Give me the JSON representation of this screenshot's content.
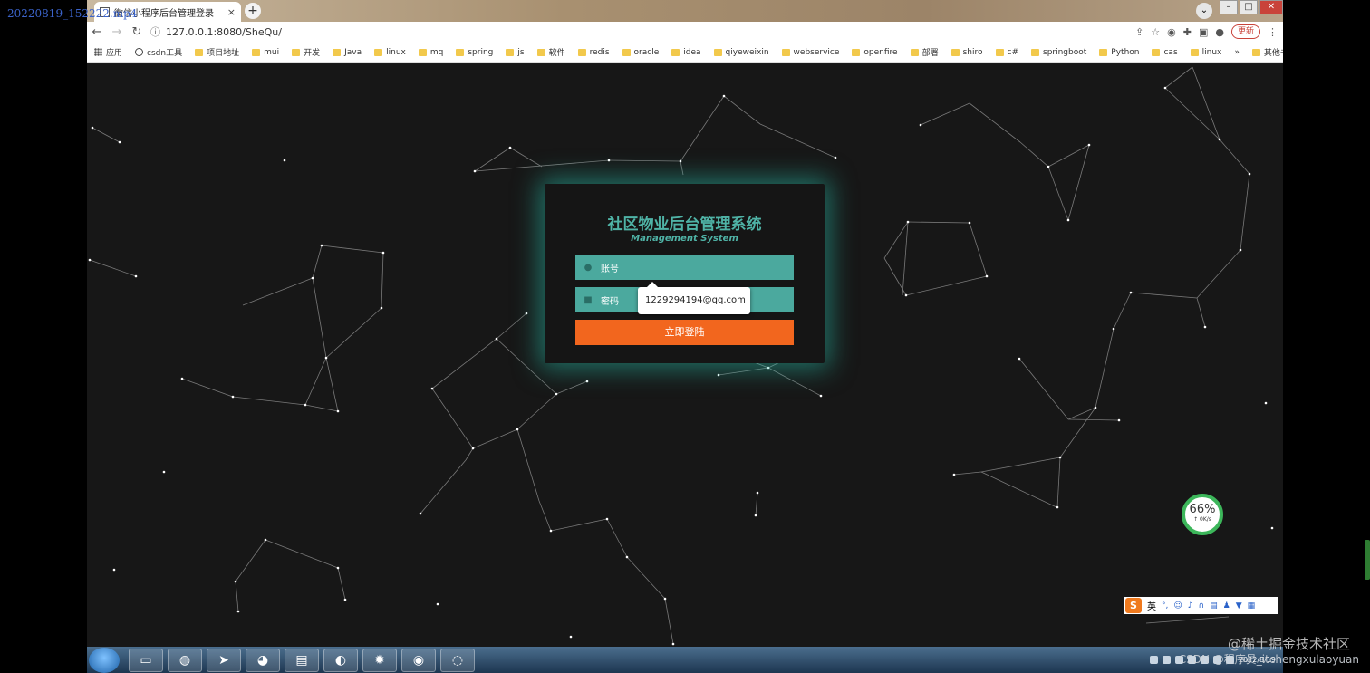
{
  "recording_label": "20220819_152222.mp4",
  "browser": {
    "tab_title": "微信小程序后台管理登录",
    "tab_close": "×",
    "new_tab": "+",
    "address": "127.0.0.1:8080/SheQu/",
    "update_button": "更新",
    "bookmarks": [
      "应用",
      "csdn工具",
      "项目地址",
      "mui",
      "开发",
      "Java",
      "linux",
      "mq",
      "spring",
      "js",
      "软件",
      "redis",
      "oracle",
      "idea",
      "qiyeweixin",
      "webservice",
      "openfire",
      "部署",
      "shiro",
      "c#",
      "springboot",
      "Python",
      "cas",
      "linux"
    ],
    "bookmarks_more": "»",
    "other_bookmarks": "其他书签"
  },
  "login": {
    "title": "社区物业后台管理系统",
    "subtitle": "Management System",
    "username_placeholder": "账号",
    "password_placeholder": "密码",
    "submit_label": "立即登陆",
    "autofill_suggestion": "1229294194@qq.com"
  },
  "speed_widget": {
    "percent": "66%",
    "rate": "↑ 0K/s"
  },
  "ime_bar": {
    "logo": "S",
    "mode": "英"
  },
  "taskbar": {
    "clock_time": "",
    "clock_date": "2022/8/19"
  },
  "watermarks": {
    "juejin": "@稀土掘金技术社区",
    "csdn": "CSDN @程序员_itchengxulaoyuan"
  },
  "colors": {
    "accent_teal": "#4fb3a6",
    "login_button": "#f2661e",
    "page_background": "#171717"
  }
}
